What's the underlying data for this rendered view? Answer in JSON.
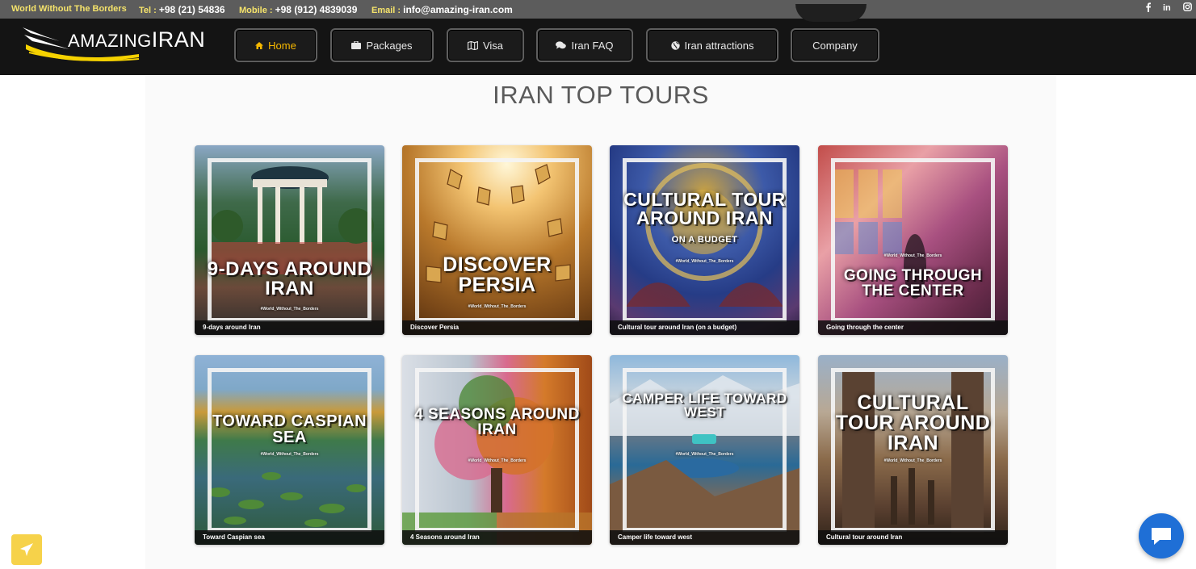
{
  "topbar": {
    "slogan": "World Without The Borders",
    "tel_label": "Tel :",
    "tel_value": "+98 (21) 54836",
    "mobile_label": "Mobile :",
    "mobile_value": "+98 (912) 4839039",
    "email_label": "Email :",
    "email_value": "info@amazing-iran.com",
    "social": [
      "facebook-icon",
      "linkedin-icon",
      "instagram-icon"
    ]
  },
  "brand": {
    "logo_text_left": "AMAZING",
    "logo_text_right": "IRAN",
    "accent": "#f6d200"
  },
  "nav": {
    "items": [
      {
        "label": "Home",
        "icon": "home-icon",
        "active": true
      },
      {
        "label": "Packages",
        "icon": "briefcase-icon",
        "active": false
      },
      {
        "label": "Visa",
        "icon": "map-icon",
        "active": false
      },
      {
        "label": "Iran FAQ",
        "icon": "chat-bubbles-icon",
        "active": false
      },
      {
        "label": "Iran attractions",
        "icon": "globe-icon",
        "active": false
      },
      {
        "label": "Company",
        "icon": "",
        "active": false
      }
    ],
    "active_color": "#f6b800"
  },
  "main": {
    "title": "IRAN TOP TOURS",
    "hashtag": "#World_Without_The_Borders",
    "tours": [
      {
        "image_title": "9-DAYS AROUND IRAN",
        "caption": "9-days around Iran"
      },
      {
        "image_title": "DISCOVER PERSIA",
        "caption": "Discover Persia"
      },
      {
        "image_title": "CULTURAL TOUR AROUND IRAN",
        "image_subtitle": "ON A BUDGET",
        "caption": "Cultural tour around Iran (on a budget)"
      },
      {
        "image_title": "GOING THROUGH THE CENTER",
        "caption": "Going through the center"
      },
      {
        "image_title": "TOWARD CASPIAN SEA",
        "caption": "Toward Caspian sea"
      },
      {
        "image_title": "4 SEASONS AROUND IRAN",
        "caption": "4 Seasons around Iran"
      },
      {
        "image_title": "CAMPER LIFE TOWARD WEST",
        "caption": "Camper life toward west"
      },
      {
        "image_title": "CULTURAL TOUR AROUND IRAN",
        "caption": "Cultural tour around Iran"
      }
    ]
  },
  "floating": {
    "left_button_icon": "airplane-icon",
    "left_button_color": "#f6d24a",
    "chat_button_icon": "chat-icon",
    "chat_button_color": "#1f6fd6"
  }
}
